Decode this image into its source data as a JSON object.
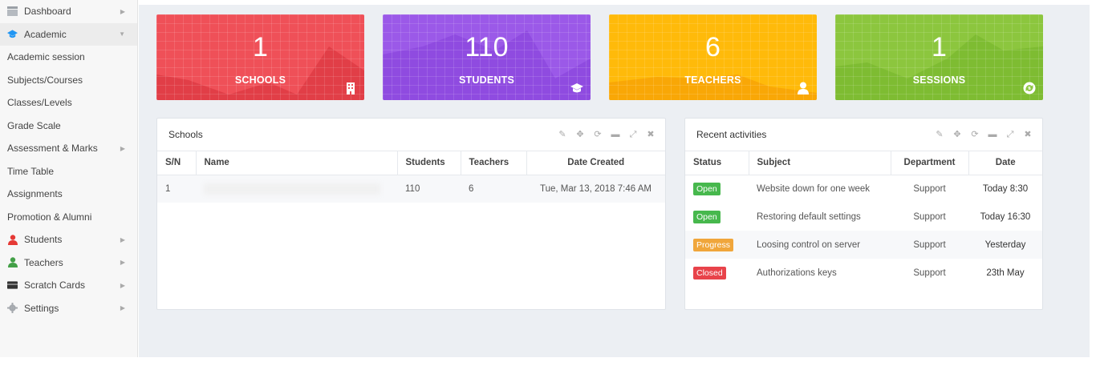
{
  "sidebar": {
    "items": [
      {
        "label": "Dashboard",
        "icon": "dashboard-icon",
        "icon_color": "#999999",
        "type": "top",
        "arrow": "right"
      },
      {
        "label": "Academic",
        "icon": "graduation-cap-icon",
        "icon_color": "#2196f3",
        "type": "top",
        "arrow": "down",
        "active": true
      },
      {
        "label": "Academic session",
        "type": "sub"
      },
      {
        "label": "Subjects/Courses",
        "type": "sub"
      },
      {
        "label": "Classes/Levels",
        "type": "sub"
      },
      {
        "label": "Grade Scale",
        "type": "sub"
      },
      {
        "label": "Assessment & Marks",
        "type": "sub",
        "arrow": "right"
      },
      {
        "label": "Time Table",
        "type": "sub"
      },
      {
        "label": "Assignments",
        "type": "sub"
      },
      {
        "label": "Promotion & Alumni",
        "type": "sub"
      },
      {
        "label": "Students",
        "icon": "user-icon",
        "icon_color": "#e53935",
        "type": "top",
        "arrow": "right"
      },
      {
        "label": "Teachers",
        "icon": "user-icon",
        "icon_color": "#43a047",
        "type": "top",
        "arrow": "right"
      },
      {
        "label": "Scratch Cards",
        "icon": "card-icon",
        "icon_color": "#333333",
        "type": "top",
        "arrow": "right"
      },
      {
        "label": "Settings",
        "icon": "gear-icon",
        "icon_color": "#999999",
        "type": "top",
        "arrow": "right"
      }
    ]
  },
  "stats": [
    {
      "value": "1",
      "label": "SCHOOLS",
      "color": "#ef5058",
      "icon": "building-icon"
    },
    {
      "value": "110",
      "label": "STUDENTS",
      "color": "#9b59e8",
      "icon": "graduation-cap-icon"
    },
    {
      "value": "6",
      "label": "TEACHERS",
      "color": "#ffba0a",
      "icon": "user-icon"
    },
    {
      "value": "1",
      "label": "SESSIONS",
      "color": "#8cc63e",
      "icon": "refresh-icon"
    }
  ],
  "schools_panel": {
    "title": "Schools",
    "columns": [
      "S/N",
      "Name",
      "Students",
      "Teachers",
      "Date Created"
    ],
    "rows": [
      {
        "sn": "1",
        "name": "",
        "students": "110",
        "teachers": "6",
        "date": "Tue, Mar 13, 2018 7:46 AM"
      }
    ]
  },
  "activities_panel": {
    "title": "Recent activities",
    "columns": [
      "Status",
      "Subject",
      "Department",
      "Date"
    ],
    "rows": [
      {
        "status": "Open",
        "status_color": "#47b84d",
        "subject": "Website down for one week",
        "department": "Support",
        "date": "Today 8:30"
      },
      {
        "status": "Open",
        "status_color": "#47b84d",
        "subject": "Restoring default settings",
        "department": "Support",
        "date": "Today 16:30"
      },
      {
        "status": "Progress",
        "status_color": "#f0a63b",
        "subject": "Loosing control on server",
        "department": "Support",
        "date": "Yesterday"
      },
      {
        "status": "Closed",
        "status_color": "#e8434a",
        "subject": "Authorizations keys",
        "department": "Support",
        "date": "23th May"
      }
    ]
  },
  "panel_tools": [
    "pencil-icon",
    "move-icon",
    "refresh-icon",
    "minus-icon",
    "expand-icon",
    "close-icon"
  ]
}
